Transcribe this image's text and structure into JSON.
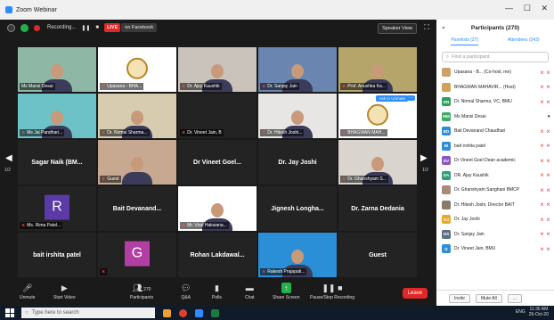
{
  "window": {
    "title": "Zoom Webinar",
    "controls": [
      "—",
      "☐",
      "✕"
    ]
  },
  "meeting_bar": {
    "recording_label": "Recording...",
    "pause_glyph": "❚❚",
    "stop_glyph": "■",
    "live_label": "LIVE",
    "live_destination": "on Facebook",
    "speaker_view_label": "Speaker View",
    "fullscreen_glyph": "⛶"
  },
  "gallery": {
    "page_left": "1/2",
    "page_right": "1/2",
    "ask_unmute_label": "Ask to Unmute",
    "more_glyph": "···",
    "tiles": [
      {
        "label": "Ms Mansi Desai",
        "type": "video",
        "bg": "#8fb7a5",
        "muted": false,
        "active": true
      },
      {
        "label": "Upasana - BHA...",
        "type": "emblem",
        "bg": "#ffffff",
        "muted": true
      },
      {
        "label": "Dr. Ajay Kaushik",
        "type": "video",
        "bg": "#c9c3bb",
        "muted": true
      },
      {
        "label": "Dr. Sanjay Jain",
        "type": "video",
        "bg": "#6a86b0",
        "muted": true
      },
      {
        "label": "Prof. Anushka Ka...",
        "type": "video",
        "bg": "#b6a56b",
        "muted": true
      },
      {
        "label": "Ms Jai Pandhari...",
        "type": "video",
        "bg": "#6dc2c8",
        "muted": true
      },
      {
        "label": "Dr. Nirmal Sharma...",
        "type": "video",
        "bg": "#d7cbb0",
        "muted": true
      },
      {
        "label": "Dr. Vineet Jain, B",
        "type": "blank",
        "muted": true
      },
      {
        "label": "Dr. Hitesh Joshi...",
        "type": "video",
        "bg": "#e8e6e4",
        "muted": true
      },
      {
        "label": "BHAGWAN MAH...",
        "type": "emblem",
        "bg": "#ffffff",
        "muted": true,
        "unmute": true
      },
      {
        "label": "Sagar Naik (BM...",
        "type": "name",
        "muted": false
      },
      {
        "label": "Guest",
        "type": "video",
        "bg": "#c7a992",
        "muted": true
      },
      {
        "label": "Dr Vineet Goel...",
        "type": "name",
        "muted": false
      },
      {
        "label": "Dr. Jay Joshi",
        "type": "name",
        "muted": false
      },
      {
        "label": "Dr. Ghanshyam S...",
        "type": "video",
        "bg": "#d9d4ce",
        "muted": true
      },
      {
        "label": "Ms. Rima Patel...",
        "type": "avatar",
        "initial": "R",
        "color": "#5b3aa8",
        "muted": true
      },
      {
        "label": "Bait Devanand...",
        "type": "name",
        "muted": false
      },
      {
        "label": "Mr. Viral Hakwana...",
        "type": "video",
        "bg": "#ffffff",
        "muted": true
      },
      {
        "label": "Jignesh Longha...",
        "type": "name",
        "muted": false
      },
      {
        "label": "Dr. Zarna Dedania",
        "type": "name",
        "muted": false
      },
      {
        "label": "bait irshita patel",
        "type": "name",
        "muted": false
      },
      {
        "label": "",
        "type": "avatar",
        "initial": "G",
        "color": "#b43fa4",
        "muted": true
      },
      {
        "label": "Rohan Lakdawal...",
        "type": "name",
        "muted": false
      },
      {
        "label": "Rakesh Prajapati...",
        "type": "video",
        "bg": "#2a8fd6",
        "muted": true
      },
      {
        "label": "Guest",
        "type": "name",
        "muted": false
      }
    ]
  },
  "toolbar": {
    "unmute": "Unmute",
    "start_video": "Start Video",
    "participants": "Participants",
    "participants_count": "270",
    "qa": "Q&A",
    "polls": "Polls",
    "chat": "Chat",
    "share_screen": "Share Screen",
    "pause_recording": "Pause/Stop Recording",
    "leave": "Leave"
  },
  "panel": {
    "title": "Participants (270)",
    "collapse_glyph": "⌄",
    "tab_panelists": "Panelists (27)",
    "tab_attendees": "Attendees (243)",
    "search_placeholder": "Find a participant",
    "participants": [
      {
        "name": "Upasana - B... (Co-host, me)",
        "initials": "",
        "color": "#c9a36b",
        "icons": "🎥̸ 🎤̸"
      },
      {
        "name": "BHAGWAN MAHAVIR... (Host)",
        "initials": "",
        "color": "#d0a35a",
        "icons": "🎥̸ 🎤̸"
      },
      {
        "name": "Dr. Nirmal Sharma, VC, BMU",
        "initials": "DN",
        "color": "#2aa05a",
        "icons": "🎥̸ 🎤̸"
      },
      {
        "name": "Ms Mansi Desai",
        "initials": "MM",
        "color": "#3ea86b",
        "icons": "🎤"
      },
      {
        "name": "Bait Devanand Chaudhari",
        "initials": "BD",
        "color": "#2e8dd8",
        "icons": "🎥̸ 🎤̸"
      },
      {
        "name": "bait irshita patel",
        "initials": "BI",
        "color": "#2e8dd8",
        "icons": "🎥̸ 🎤̸"
      },
      {
        "name": "Dr Vineet Goel Dean academic",
        "initials": "DV",
        "color": "#8a55c4",
        "icons": "🎥̸ 🎤̸"
      },
      {
        "name": "DR. Ajay Kaushik",
        "initials": "DA",
        "color": "#2e9f78",
        "icons": "🎥̸ 🎤̸"
      },
      {
        "name": "Dr. Ghanshyam Sanghani BMCP",
        "initials": "",
        "color": "#a88a7a",
        "icons": "🎥̸ 🎤̸"
      },
      {
        "name": "Dr. Hitesh Joshi, Director BAIT",
        "initials": "",
        "color": "#8b7a6a",
        "icons": "🎥̸ 🎤̸"
      },
      {
        "name": "Dr. Jay Joshi",
        "initials": "DJ",
        "color": "#e8a82e",
        "icons": "🎥̸ 🎤̸"
      },
      {
        "name": "Dr. Sanjay Jain",
        "initials": "DS",
        "color": "#5b6e85",
        "icons": "🎥̸ 🎤̸"
      },
      {
        "name": "Dr. Vineet Jain, BMU",
        "initials": "D",
        "color": "#2e8dd8",
        "icons": "🎥̸ 🎤̸"
      }
    ],
    "invite": "Invite",
    "mute_all": "Mute All",
    "more": "..."
  },
  "taskbar": {
    "search_placeholder": "Type here to search",
    "time": "11:36 AM",
    "date": "26-Oct-20",
    "lang": "ENG"
  }
}
